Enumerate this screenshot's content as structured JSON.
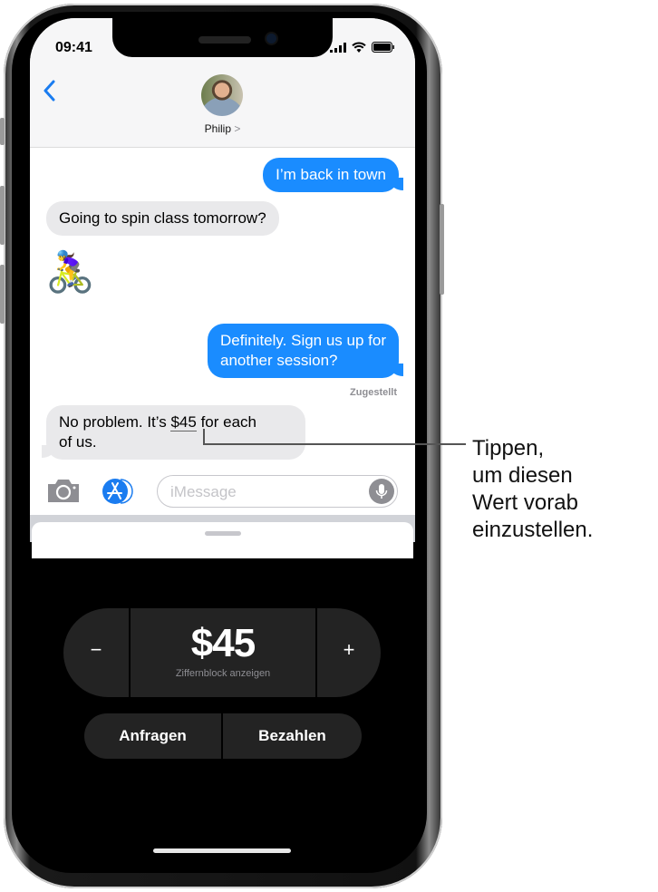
{
  "status_bar": {
    "time": "09:41",
    "icons": [
      "cellular-signal-icon",
      "wifi-icon",
      "battery-icon"
    ]
  },
  "nav": {
    "back_icon": "chevron-left-icon",
    "contact_name": "Philip",
    "contact_chevron": ">"
  },
  "messages": [
    {
      "direction": "outgoing",
      "text": "I’m back in town"
    },
    {
      "direction": "incoming",
      "text": "Going to spin class tomorrow?"
    },
    {
      "direction": "incoming",
      "emoji": "🚴‍♀️",
      "text": "woman-biking-emoji"
    },
    {
      "direction": "outgoing",
      "text_line1": "Definitely. Sign us up for",
      "text_line2": "another session?"
    },
    {
      "direction": "incoming",
      "text_before": "No problem. It’s ",
      "amount": "$45",
      "text_after": " for each",
      "text_line2": "of us."
    }
  ],
  "delivery_status": "Zugestellt",
  "composer": {
    "placeholder": "iMessage",
    "camera_icon": "camera-icon",
    "apps_icon": "app-store-icon",
    "mic_icon": "microphone-icon"
  },
  "apple_pay": {
    "minus_label": "−",
    "amount": "$45",
    "keypad_hint": "Ziffernblock anzeigen",
    "plus_label": "+",
    "request_label": "Anfragen",
    "pay_label": "Bezahlen"
  },
  "callout": {
    "line1": "Tippen,",
    "line2": "um diesen",
    "line3": "Wert vorab",
    "line4": "einzustellen."
  }
}
